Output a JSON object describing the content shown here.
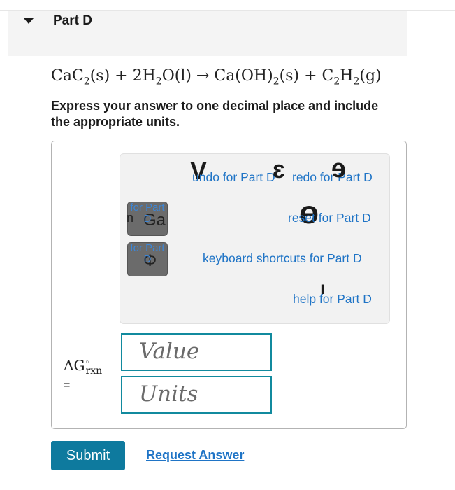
{
  "part": {
    "title": "Part D"
  },
  "question": {
    "equation": {
      "lhs1": "CaC",
      "lhs1_sub": "2",
      "lhs1_state": "(s) + 2H",
      "h2o_sub": "2",
      "h2o_rest": "O(l) → Ca(OH)",
      "caoh_sub": "2",
      "caoh_state": "(s) + C",
      "c2_sub": "2",
      "h": "H",
      "h2_sub": "2",
      "end": "(g)"
    },
    "instructions": "Express your answer to one decimal place and include the appropriate units."
  },
  "toolbar": {
    "undo": "undo for Part D",
    "redo": "redo for Part D",
    "reset": "reset for Part D",
    "keyboard": "keyboard shortcuts for Part D",
    "help": "help for Part D",
    "template1_for": "for Part D",
    "template1_n": "n",
    "template1_sym": "Ga",
    "template2_for": "for Part D",
    "template2_sym": "Φ"
  },
  "answer": {
    "label_prefix": "ΔG",
    "label_sup": "◦",
    "label_sub": "rxn",
    "equals": "=",
    "value_placeholder": "Value",
    "units_placeholder": "Units"
  },
  "actions": {
    "submit": "Submit",
    "request": "Request Answer"
  },
  "colors": {
    "accent": "#0e7a9e",
    "link": "#1f74c6",
    "field_border": "#118a9e"
  }
}
